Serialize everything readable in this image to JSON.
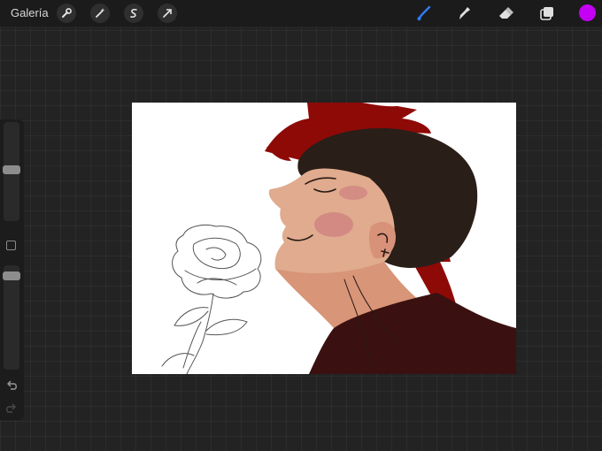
{
  "topbar": {
    "gallery_label": "Galería",
    "left_tools": [
      "wrench-icon",
      "magic-wand-icon",
      "selection-icon",
      "transform-arrow-icon"
    ],
    "right_tools": [
      "brush-icon",
      "smudge-icon",
      "eraser-icon",
      "layers-icon"
    ],
    "active_tool": "brush-icon",
    "active_color": "#c400f5",
    "accent_color": "#2f7df6"
  },
  "sidebar": {
    "brush_size_level": 0.32,
    "opacity_level": 0.27,
    "controls": [
      "brush-size-slider",
      "modify-button",
      "opacity-slider",
      "undo-icon",
      "redo-icon"
    ]
  },
  "canvas": {
    "background": "#ffffff",
    "content": "digital-painting"
  }
}
